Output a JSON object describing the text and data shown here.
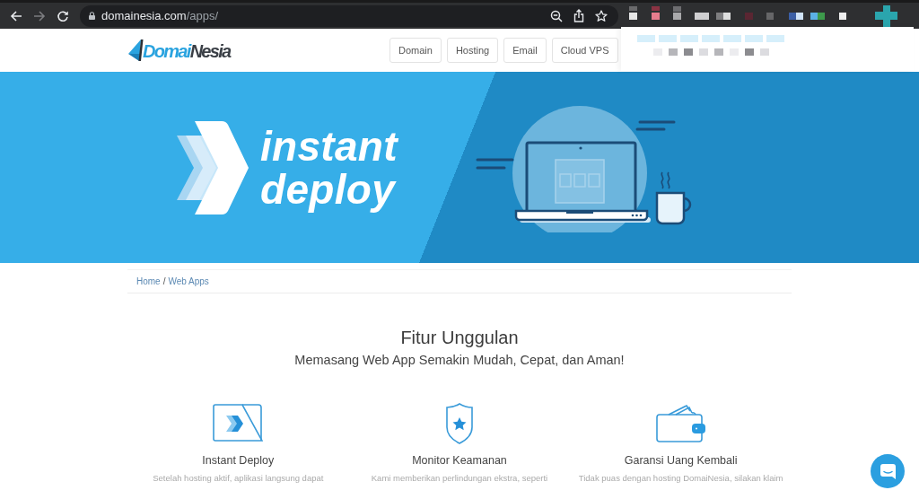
{
  "browser": {
    "url_host": "domainesia.com",
    "url_path": "/apps/"
  },
  "header": {
    "logo_parts": [
      "Domai",
      "Nesia"
    ],
    "nav": [
      "Domain",
      "Hosting",
      "Email",
      "Cloud VPS"
    ]
  },
  "banner": {
    "title_lines": [
      "instant",
      "deploy"
    ]
  },
  "breadcrumb": {
    "items": [
      "Home",
      "Web Apps"
    ],
    "separator": "/"
  },
  "features_section": {
    "title": "Fitur Unggulan",
    "subtitle": "Memasang Web App Semakin Mudah, Cepat, dan Aman!"
  },
  "features": [
    {
      "kind": "deploy",
      "title": "Instant Deploy",
      "description": "Setelah hosting aktif, aplikasi langsung dapat"
    },
    {
      "kind": "shield",
      "title": "Monitor Keamanan",
      "description": "Kami memberikan perlindungan ekstra, seperti"
    },
    {
      "kind": "wallet",
      "title": "Garansi Uang Kembali",
      "description": "Tidak puas dengan hosting DomaiNesia, silakan klaim"
    }
  ]
}
